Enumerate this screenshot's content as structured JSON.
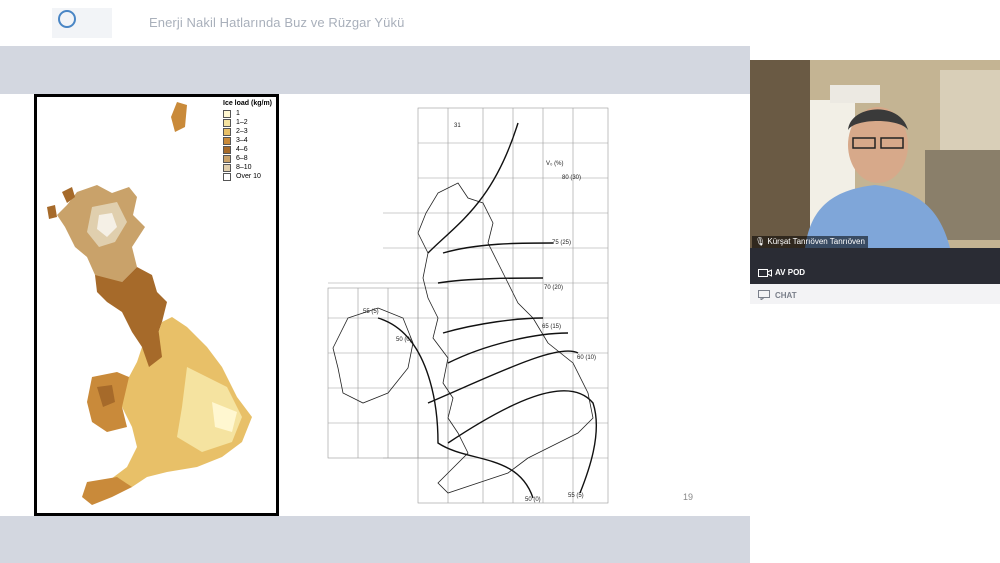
{
  "header": {
    "title": "Enerji Nakil Hatlarında Buz ve Rüzgar Yükü"
  },
  "ice_map": {
    "legend_title": "Ice load (kg/m)",
    "legend": [
      {
        "label": "1",
        "color": "#fff7d0"
      },
      {
        "label": "1–2",
        "color": "#f5e3a0"
      },
      {
        "label": "2–3",
        "color": "#e8c068"
      },
      {
        "label": "3–4",
        "color": "#c98a3a"
      },
      {
        "label": "4–6",
        "color": "#a66a2a"
      },
      {
        "label": "6–8",
        "color": "#c9a26a"
      },
      {
        "label": "8–10",
        "color": "#e0cfae"
      },
      {
        "label": "Over 10",
        "color": "#ffffff"
      }
    ]
  },
  "wind_map": {
    "header_label": "V₀ (%)",
    "corner_label": "31",
    "contours": [
      "80 (30)",
      "75 (25)",
      "70 (20)",
      "65 (15)",
      "60 (10)",
      "55 (5)",
      "50 (0)",
      "55 (5)",
      "50 (0)"
    ]
  },
  "slide": {
    "page_number": "19"
  },
  "participant": {
    "name": "Kürşat Tanrıöven Tanrıöven"
  },
  "panels": {
    "av_pod": "AV POD",
    "chat": "CHAT"
  }
}
